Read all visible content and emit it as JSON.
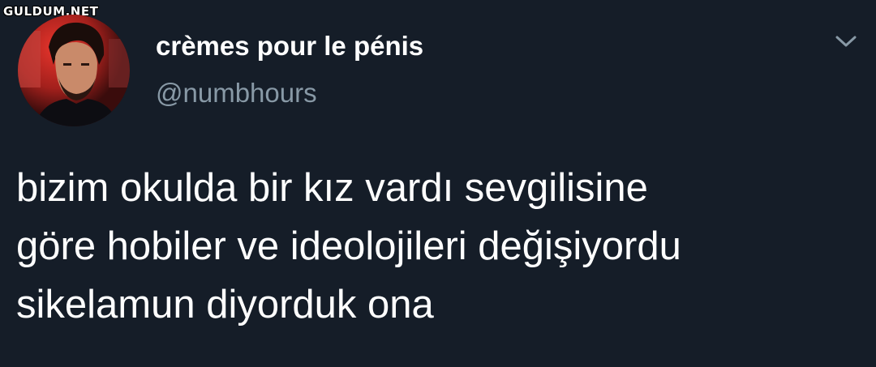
{
  "watermark": {
    "text": "GULDUM.NET"
  },
  "tweet": {
    "author": {
      "display_name": "crèmes pour le pénis",
      "handle": "@numbhours",
      "avatar_icon": "profile-photo"
    },
    "menu_icon": "chevron-down-icon",
    "text_lines": [
      "bizim okulda bir kız vardı sevgilisine",
      "göre hobiler ve ideolojileri değişiyordu",
      "sikelamun diyorduk ona"
    ]
  },
  "colors": {
    "background": "#151d28",
    "text_primary": "#ffffff",
    "text_secondary": "#8899a6"
  }
}
